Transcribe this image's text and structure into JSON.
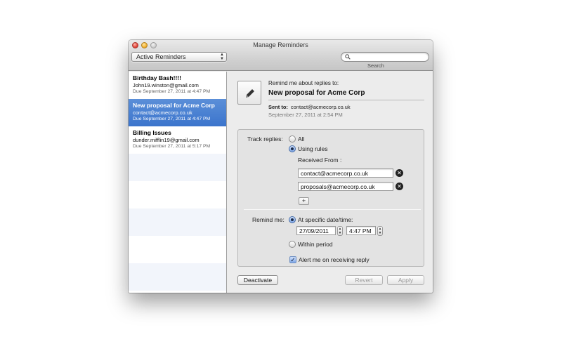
{
  "window": {
    "title": "Manage Reminders"
  },
  "toolbar": {
    "filter_label": "Active Reminders",
    "search_placeholder": "",
    "search_caption": "Search"
  },
  "reminders": [
    {
      "title": "Birthday Bash!!!!",
      "email": "John19.winston@gmail.com",
      "due": "Due September 27, 2011 at 4:47 PM",
      "selected": false
    },
    {
      "title": "New proposal for Acme Corp",
      "email": "contact@acmecorp.co.uk",
      "due": "Due September 27, 2011 at 4:47 PM",
      "selected": true
    },
    {
      "title": "Billing Issues",
      "email": "dunder.mifflin19@gmail.com",
      "due": "Due September 27, 2011 at 5:17 PM",
      "selected": false
    }
  ],
  "detail": {
    "remind_label": "Remind me about replies to:",
    "subject": "New proposal for Acme Corp",
    "sent_to_label": "Sent to:",
    "sent_to_value": "contact@acmecorp.co.uk",
    "sent_date": "September 27, 2011 at 2:54 PM",
    "track_label": "Track replies:",
    "opt_all": "All",
    "opt_rules": "Using rules",
    "received_from": "Received From :",
    "addresses": [
      "contact@acmecorp.co.uk",
      "proposals@acmecorp.co.uk"
    ],
    "plus": "+",
    "remind_me_label": "Remind me:",
    "opt_specific": "At specific date/time:",
    "date_value": "27/09/2011",
    "time_value": "4:47 PM",
    "opt_within": "Within period",
    "alert_label": "Alert me on receiving reply",
    "remove_glyph": "✕",
    "check_glyph": "✓"
  },
  "buttons": {
    "deactivate": "Deactivate",
    "revert": "Revert",
    "apply": "Apply"
  }
}
